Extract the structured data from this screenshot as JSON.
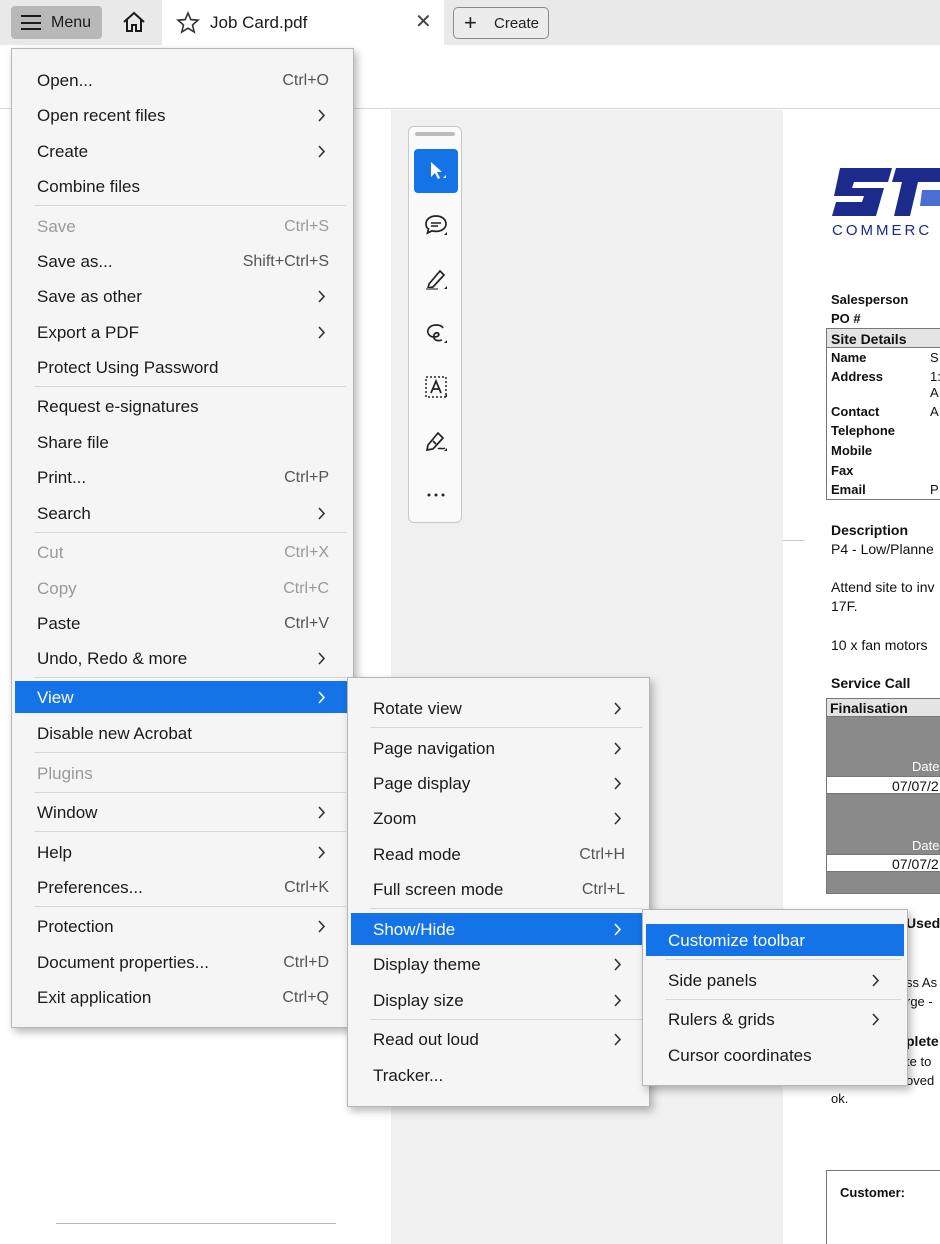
{
  "tabbar": {
    "menu_label": "Menu",
    "tab_title": "Job Card.pdf",
    "tab_close": "✕",
    "create_label": "Create"
  },
  "main_menu": {
    "items": [
      {
        "label": "Open...",
        "shortcut": "Ctrl+O",
        "disabled": false,
        "submenu": false
      },
      {
        "label": "Open recent files",
        "shortcut": "",
        "disabled": false,
        "submenu": true
      },
      {
        "label": "Create",
        "shortcut": "",
        "disabled": false,
        "submenu": true
      },
      {
        "label": "Combine files",
        "shortcut": "",
        "disabled": false,
        "submenu": false
      },
      {
        "label": "Save",
        "shortcut": "Ctrl+S",
        "disabled": true,
        "submenu": false
      },
      {
        "label": "Save as...",
        "shortcut": "Shift+Ctrl+S",
        "disabled": false,
        "submenu": false
      },
      {
        "label": "Save as other",
        "shortcut": "",
        "disabled": false,
        "submenu": true
      },
      {
        "label": "Export a PDF",
        "shortcut": "",
        "disabled": false,
        "submenu": true
      },
      {
        "label": "Protect Using Password",
        "shortcut": "",
        "disabled": false,
        "submenu": false
      },
      {
        "label": "Request e-signatures",
        "shortcut": "",
        "disabled": false,
        "submenu": false
      },
      {
        "label": "Share file",
        "shortcut": "",
        "disabled": false,
        "submenu": false
      },
      {
        "label": "Print...",
        "shortcut": "Ctrl+P",
        "disabled": false,
        "submenu": false
      },
      {
        "label": "Search",
        "shortcut": "",
        "disabled": false,
        "submenu": true
      },
      {
        "label": "Cut",
        "shortcut": "Ctrl+X",
        "disabled": true,
        "submenu": false
      },
      {
        "label": "Copy",
        "shortcut": "Ctrl+C",
        "disabled": true,
        "submenu": false
      },
      {
        "label": "Paste",
        "shortcut": "Ctrl+V",
        "disabled": false,
        "submenu": false
      },
      {
        "label": "Undo, Redo & more",
        "shortcut": "",
        "disabled": false,
        "submenu": true
      },
      {
        "label": "View",
        "shortcut": "",
        "disabled": false,
        "submenu": true,
        "highlighted": true
      },
      {
        "label": "Disable new Acrobat",
        "shortcut": "",
        "disabled": false,
        "submenu": false
      },
      {
        "label": "Plugins",
        "shortcut": "",
        "disabled": true,
        "submenu": false
      },
      {
        "label": "Window",
        "shortcut": "",
        "disabled": false,
        "submenu": true
      },
      {
        "label": "Help",
        "shortcut": "",
        "disabled": false,
        "submenu": true
      },
      {
        "label": "Preferences...",
        "shortcut": "Ctrl+K",
        "disabled": false,
        "submenu": false
      },
      {
        "label": "Protection",
        "shortcut": "",
        "disabled": false,
        "submenu": true
      },
      {
        "label": "Document properties...",
        "shortcut": "Ctrl+D",
        "disabled": false,
        "submenu": false
      },
      {
        "label": "Exit application",
        "shortcut": "Ctrl+Q",
        "disabled": false,
        "submenu": false
      }
    ]
  },
  "view_menu": {
    "items": [
      {
        "label": "Rotate view",
        "shortcut": "",
        "submenu": true
      },
      {
        "label": "Page navigation",
        "shortcut": "",
        "submenu": true
      },
      {
        "label": "Page display",
        "shortcut": "",
        "submenu": true
      },
      {
        "label": "Zoom",
        "shortcut": "",
        "submenu": true
      },
      {
        "label": "Read mode",
        "shortcut": "Ctrl+H",
        "submenu": false
      },
      {
        "label": "Full screen mode",
        "shortcut": "Ctrl+L",
        "submenu": false
      },
      {
        "label": "Show/Hide",
        "shortcut": "",
        "submenu": true,
        "highlighted": true
      },
      {
        "label": "Display theme",
        "shortcut": "",
        "submenu": true
      },
      {
        "label": "Display size",
        "shortcut": "",
        "submenu": true
      },
      {
        "label": "Read out loud",
        "shortcut": "",
        "submenu": true
      },
      {
        "label": "Tracker...",
        "shortcut": "",
        "submenu": false
      }
    ]
  },
  "showhide_menu": {
    "items": [
      {
        "label": "Customize toolbar",
        "submenu": false,
        "highlighted": true
      },
      {
        "label": "Side panels",
        "submenu": true
      },
      {
        "label": "Rulers & grids",
        "submenu": true
      },
      {
        "label": "Cursor coordinates",
        "submenu": false
      }
    ]
  },
  "quick_tools": {
    "icons": [
      "select-cursor-icon",
      "comment-icon",
      "highlight-pen-icon",
      "draw-freeform-icon",
      "text-box-icon",
      "sign-icon",
      "more-tools-icon"
    ]
  },
  "document": {
    "logo_sub": "COMMERC",
    "salesperson": "Salesperson",
    "po": "PO #",
    "site_details": "Site Details",
    "fields": [
      "Name",
      "Address",
      "Contact",
      "Telephone",
      "Mobile",
      "Fax",
      "Email"
    ],
    "field_value_fragments": [
      "S",
      "1:",
      "A",
      "A",
      "P"
    ],
    "description_label": "Description",
    "description_line": "P4 - Low/Planne",
    "attend_line1": "Attend site to inv",
    "attend_line2": "17F.",
    "fan_line": "10 x fan motors",
    "service_call": "Service Call",
    "finalisation": "Finalisation",
    "date_label": "Date",
    "date_value": "07/07/2",
    "used_fragment": "Used",
    "ss_fragment": "ss As",
    "rge_fragment": "rge -",
    "plete_fragment": "plete",
    "te_to_fragment": "te to",
    "oved_fragment": "oved",
    "ok_fragment": "ok.",
    "customer_label": "Customer:"
  },
  "colors": {
    "highlight": "#1473e6",
    "menu_bg": "#f5f5f5",
    "disabled_text": "#9a9a9a",
    "logo_blue": "#1c2a8c"
  }
}
